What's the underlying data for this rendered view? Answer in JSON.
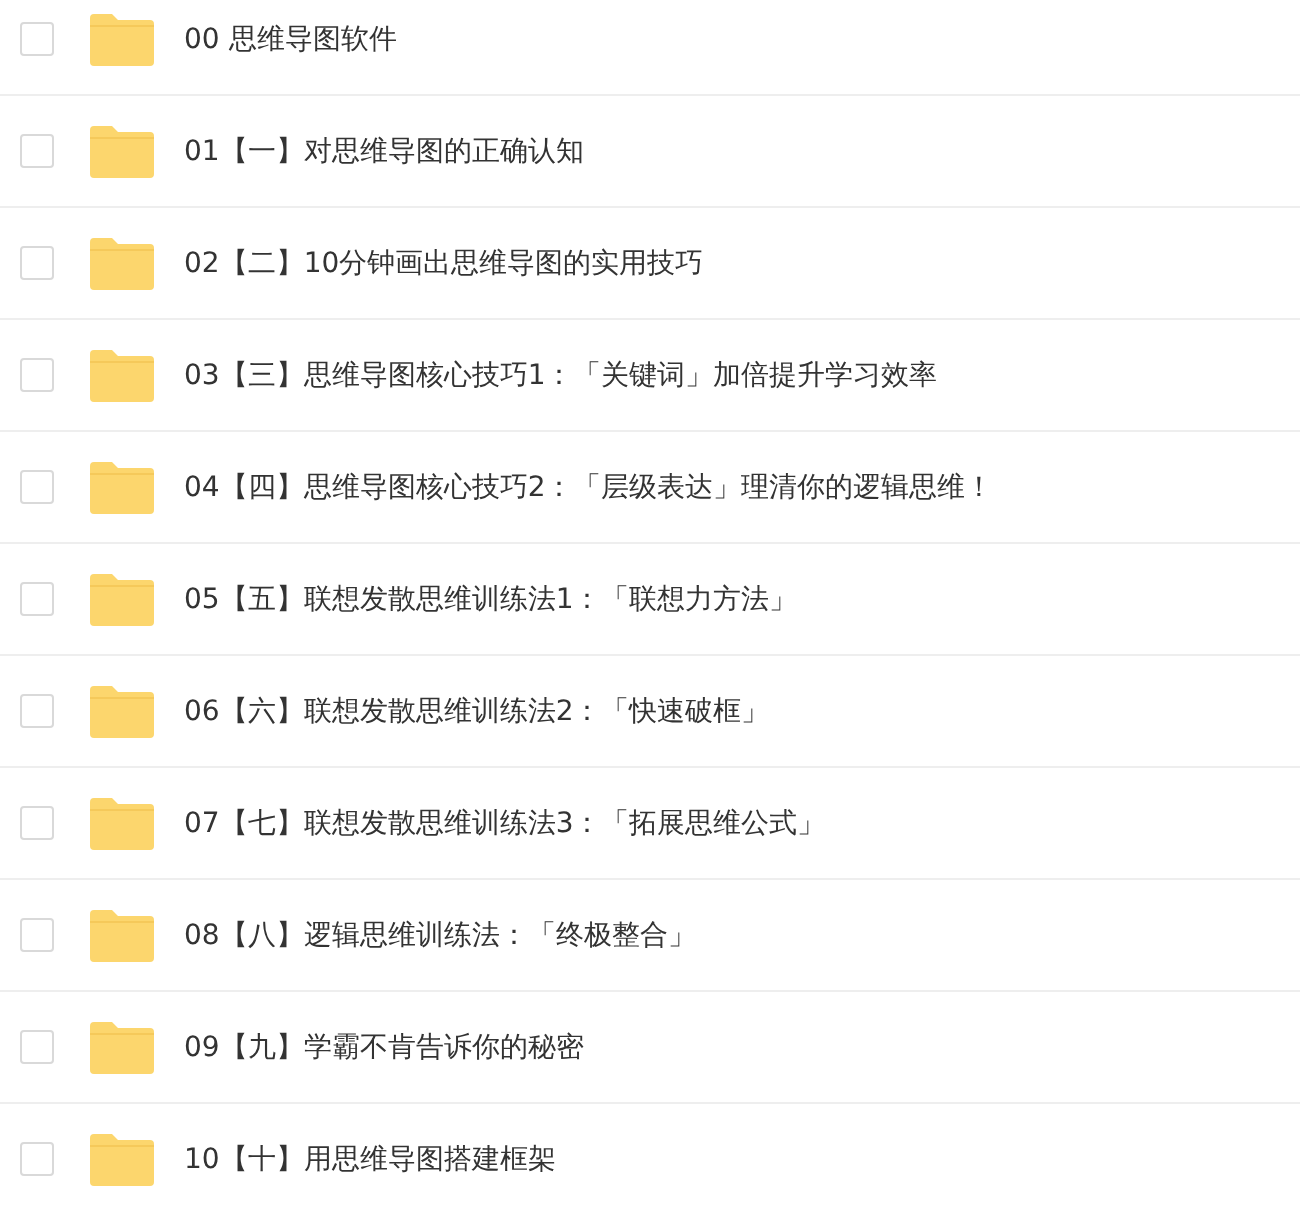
{
  "items": [
    {
      "name": "00 思维导图软件",
      "checked": false
    },
    {
      "name": "01【一】对思维导图的正确认知",
      "checked": false
    },
    {
      "name": "02【二】10分钟画出思维导图的实用技巧",
      "checked": false
    },
    {
      "name": "03【三】思维导图核心技巧1：「关键词」加倍提升学习效率",
      "checked": false
    },
    {
      "name": "04【四】思维导图核心技巧2：「层级表达」理清你的逻辑思维！",
      "checked": false
    },
    {
      "name": "05【五】联想发散思维训练法1：「联想力方法」",
      "checked": false
    },
    {
      "name": "06【六】联想发散思维训练法2：「快速破框」",
      "checked": false
    },
    {
      "name": "07【七】联想发散思维训练法3：「拓展思维公式」",
      "checked": false
    },
    {
      "name": "08【八】逻辑思维训练法：「终极整合」",
      "checked": false
    },
    {
      "name": "09【九】学霸不肯告诉你的秘密",
      "checked": false
    },
    {
      "name": "10【十】用思维导图搭建框架",
      "checked": false
    }
  ]
}
